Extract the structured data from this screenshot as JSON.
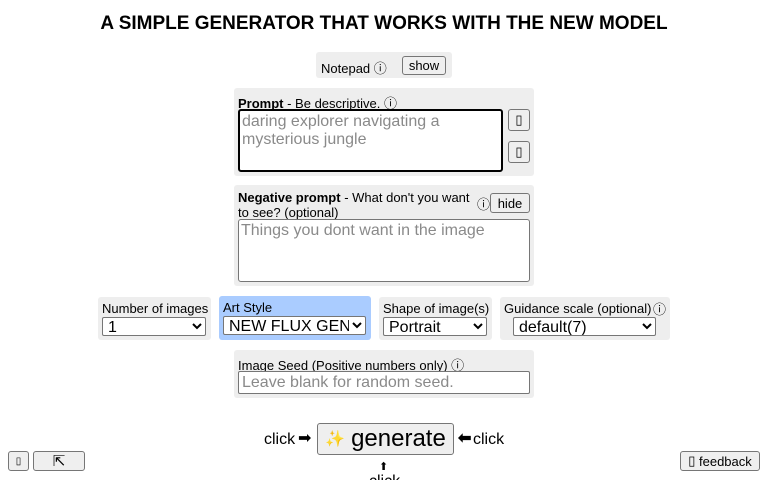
{
  "header": {
    "title": "A SIMPLE GENERATOR THAT WORKS WITH THE NEW MODEL"
  },
  "notepad": {
    "label": "Notepad",
    "info_icon": "ⓘ",
    "button_label": "show"
  },
  "prompt": {
    "label_bold": "Prompt",
    "label_rest": " - Be descriptive.",
    "info_icon": "ⓘ",
    "placeholder": "daring explorer navigating a mysterious jungle",
    "side_button_1": "▯",
    "side_button_2": "▯"
  },
  "negative_prompt": {
    "label_bold": "Negative prompt",
    "label_rest": " - What don't you want to see? (optional)",
    "info_icon": "ⓘ",
    "button_label": "hide",
    "placeholder": "Things you dont want in the image"
  },
  "options": {
    "num_images": {
      "label": "Number of images",
      "value": "1"
    },
    "art_style": {
      "label": "Art Style",
      "value": "NEW FLUX GEN"
    },
    "shape": {
      "label": "Shape of image(s)",
      "value": "Portrait"
    },
    "guidance": {
      "label": "Guidance scale (optional)",
      "info_icon": "ⓘ",
      "value": "default(7)"
    }
  },
  "seed": {
    "label": "Image Seed (Positive numbers only)",
    "info_icon": "ⓘ",
    "placeholder": "Leave blank for random seed."
  },
  "generate": {
    "click_left": "click",
    "arrow_right": "➡",
    "sparkle_icon": "✨",
    "button_label": "generate",
    "arrow_left": "⬅",
    "click_right": "click",
    "arrow_up": "⬆",
    "click_below": "click"
  },
  "bottom": {
    "left_button": "▯",
    "up_button": "⇱",
    "feedback_icon": "▯",
    "feedback_label": "feedback"
  }
}
